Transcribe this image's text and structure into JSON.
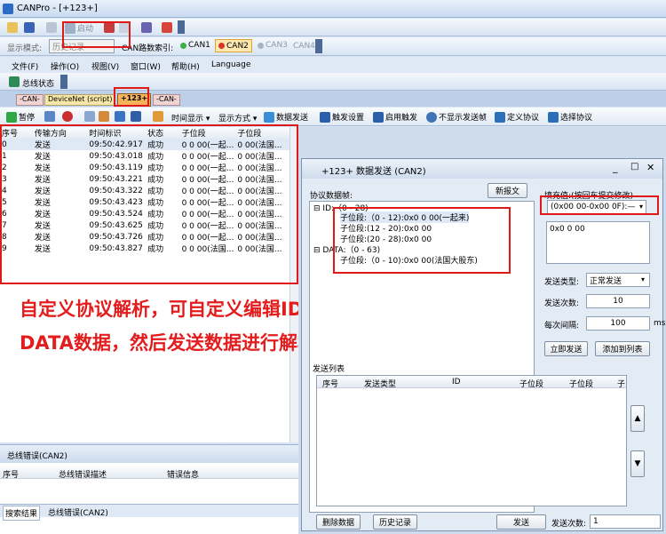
{
  "window": {
    "title": "CANPro - [+123+]"
  },
  "quick_toolbar": {
    "start_label": "启动"
  },
  "mode_bar": {
    "mode_label": "显示模式:",
    "mode_value": "历史记录",
    "index_label": "CAN路数索引:",
    "can_buttons": [
      "CAN1",
      "CAN2",
      "CAN3",
      "CAN4"
    ]
  },
  "menu": [
    "文件(F)",
    "操作(O)",
    "视图(V)",
    "窗口(W)",
    "帮助(H)",
    "Language"
  ],
  "bus_status_label": "总线状态",
  "doc_tabs": [
    "-CAN-",
    "DeviceNet (script)",
    "+123+",
    "-CAN-"
  ],
  "main_toolbar": {
    "pause": "暂停",
    "time_display": "时间显示",
    "display_mode": "显示方式",
    "data_send": "数据发送",
    "trigger_settings": "触发设置",
    "enable_trigger": "启用触发",
    "hide_send": "不显示发送帧",
    "define_protocol": "定义协议",
    "select_protocol": "选择协议"
  },
  "frame_table": {
    "columns": [
      "序号",
      "传输方向",
      "时间标识",
      "状态",
      "子位段",
      "子位段"
    ],
    "rows": [
      [
        "0",
        "发送",
        "09:50:42.917",
        "成功",
        "0 0 00(一起...",
        "0 00(法国..."
      ],
      [
        "1",
        "发送",
        "09:50:43.018",
        "成功",
        "0 0 00(一起...",
        "0 00(法国..."
      ],
      [
        "2",
        "发送",
        "09:50:43.119",
        "成功",
        "0 0 00(一起...",
        "0 00(法国..."
      ],
      [
        "3",
        "发送",
        "09:50:43.221",
        "成功",
        "0 0 00(一起...",
        "0 00(法国..."
      ],
      [
        "4",
        "发送",
        "09:50:43.322",
        "成功",
        "0 0 00(一起...",
        "0 00(法国..."
      ],
      [
        "5",
        "发送",
        "09:50:43.423",
        "成功",
        "0 0 00(一起...",
        "0 00(法国..."
      ],
      [
        "6",
        "发送",
        "09:50:43.524",
        "成功",
        "0 0 00(一起...",
        "0 00(法国..."
      ],
      [
        "7",
        "发送",
        "09:50:43.625",
        "成功",
        "0 0 00(一起...",
        "0 00(法国..."
      ],
      [
        "8",
        "发送",
        "09:50:43.726",
        "成功",
        "0 0 00(一起...",
        "0 00(法国..."
      ],
      [
        "9",
        "发送",
        "09:50:43.827",
        "成功",
        "0 0 00(法国...",
        "0 00(法国..."
      ]
    ]
  },
  "annotation": {
    "line1": "自定义协议解析，可自定义编辑ID以及",
    "line2": "DATA数据，然后发送数据进行解析"
  },
  "error_panel": {
    "title": "总线错误(CAN2)",
    "columns": [
      "序号",
      "总线错误描述",
      "错误信息"
    ],
    "tabs": [
      "搜索结果",
      "总线错误(CAN2)"
    ]
  },
  "dialog": {
    "title": "+123+ 数据发送 (CAN2)",
    "protocol_label": "协议数据帧:",
    "new_message": "新报文",
    "tree": {
      "id_node": "ID:（0 - 28)",
      "id_children": [
        "子位段:（0 - 12):0x0 0 00(一起来)",
        "子位段:(12 - 20):0x0 00",
        "子位段:(20 - 28):0x0 00"
      ],
      "data_node": "DATA:（0 - 63)",
      "data_children": [
        "子位段:（0 - 10):0x0 00(法国大股东)"
      ]
    },
    "fill_label": "填充值:(按回车提交修改)",
    "fill_select": "(0x00 00-0x00 0F):—",
    "fill_text": "0x0 0 00",
    "send_type_label": "发送类型:",
    "send_type_value": "正常发送",
    "send_count_label": "发送次数:",
    "send_count_value": "10",
    "interval_label": "每次间隔:",
    "interval_value": "100",
    "interval_unit": "ms",
    "send_now": "立即发送",
    "add_to_list": "添加到列表",
    "send_list_title": "发送列表",
    "list_columns": [
      "序号",
      "发送类型",
      "ID",
      "子位段",
      "子位段",
      "子"
    ],
    "delete_data": "删除数据",
    "history": "历史记录",
    "send": "发送",
    "bottom_count_label": "发送次数:",
    "bottom_count_value": "1"
  }
}
